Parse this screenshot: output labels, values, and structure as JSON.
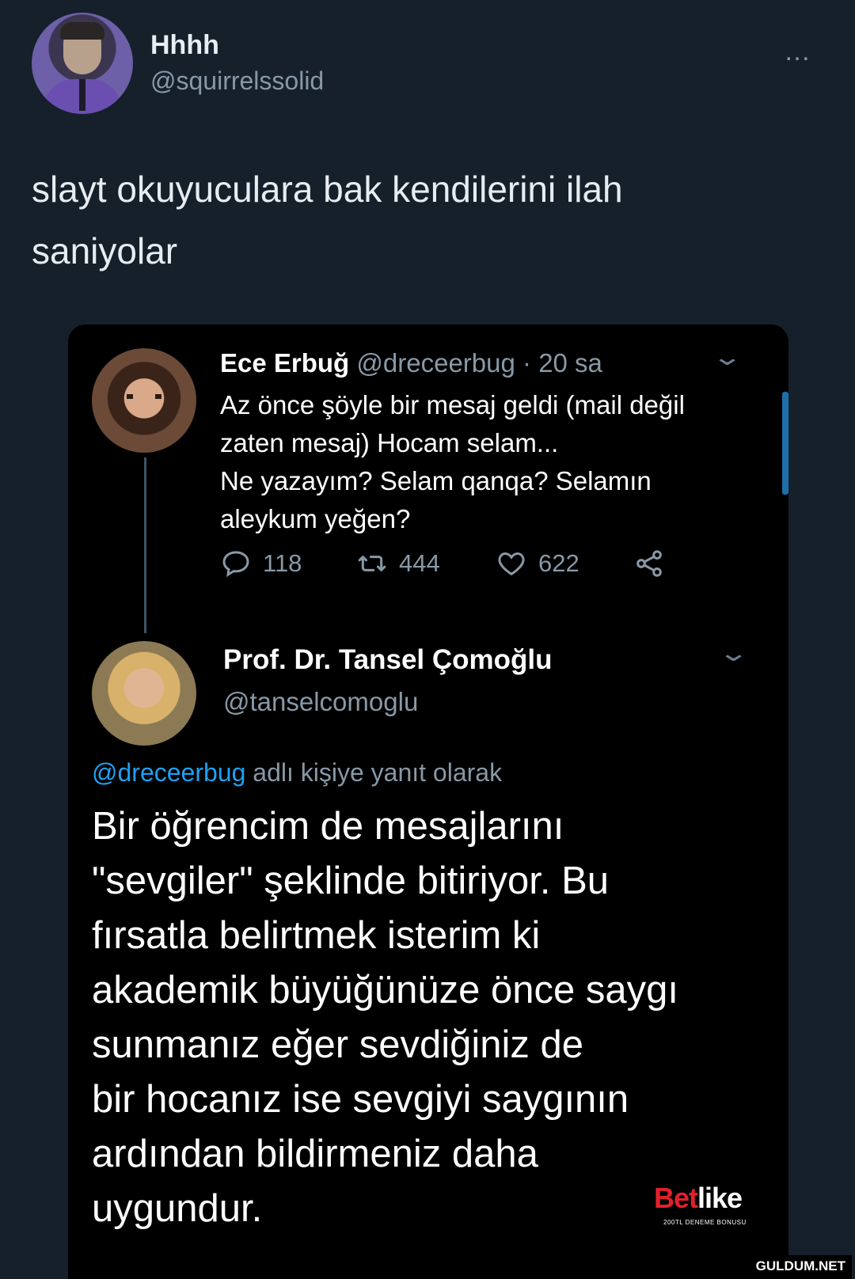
{
  "header": {
    "display_name": "Hhhh",
    "handle": "@squirrelssolid",
    "more_icon": "…"
  },
  "tweet": {
    "text_line1": "slayt okuyuculara bak kendilerini ilah",
    "text_line2": "saniyolar"
  },
  "quoted": {
    "ece": {
      "name": "Ece Erbuğ",
      "handle": "@dreceerbug",
      "separator": "·",
      "time": "20 sa",
      "lines": [
        "Az önce şöyle bir mesaj geldi (mail değil",
        "zaten mesaj) Hocam selam...",
        "Ne yazayım? Selam qanqa? Selamın",
        "aleykum yeğen?"
      ],
      "replies": "118",
      "retweets": "444",
      "likes": "622"
    },
    "tansel": {
      "name": "Prof. Dr. Tansel Çomoğlu",
      "handle": "@tanselcomoglu",
      "reply_to_handle": "@dreceerbug",
      "reply_to_suffix": "adlı kişiye yanıt olarak",
      "lines": [
        "Bir öğrencim de mesajlarını",
        "\"sevgiler\" şeklinde bitiriyor. Bu",
        "fırsatla belirtmek isterim ki",
        "akademik büyüğünüze önce saygı",
        "sunmanız eğer sevdiğiniz de",
        "bir hocanız ise sevgiyi saygının",
        "ardından bildirmeniz daha",
        "uygundur."
      ]
    }
  },
  "watermarks": {
    "betlike_b": "Bet",
    "betlike_rest": "like",
    "betlike_sub": "200TL DENEME BONUSU",
    "site": "GULDUM.NET"
  },
  "colors": {
    "background": "#15202b",
    "card": "#000000",
    "link": "#1da1f2",
    "muted": "#8899a6"
  }
}
